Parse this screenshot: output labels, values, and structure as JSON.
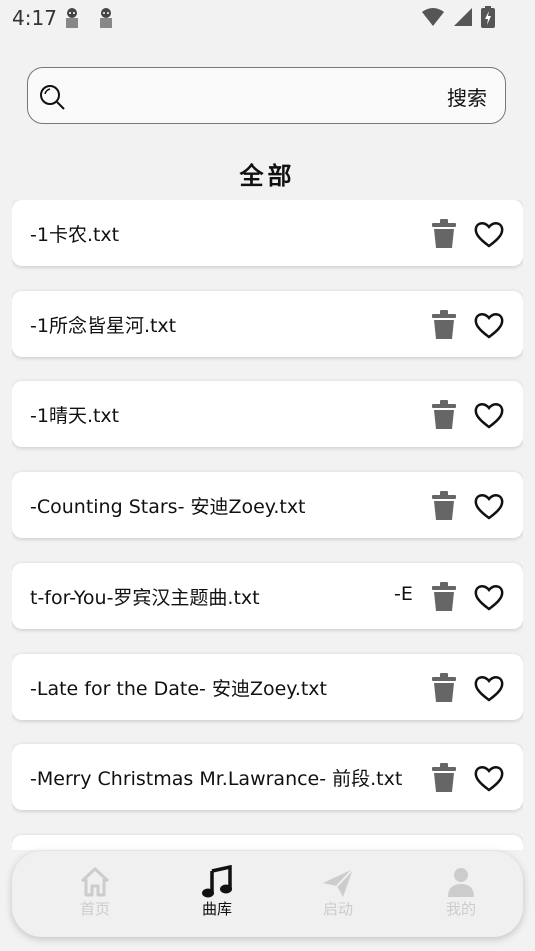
{
  "status_bar": {
    "time": "4:17"
  },
  "search": {
    "placeholder": "",
    "button_label": "搜索"
  },
  "section_title": "全部",
  "files": [
    {
      "name": "-1卡农.txt",
      "suffix": ""
    },
    {
      "name": "-1所念皆星河.txt",
      "suffix": ""
    },
    {
      "name": "-1晴天.txt",
      "suffix": ""
    },
    {
      "name": "-Counting Stars- 安迪Zoey.txt",
      "suffix": ""
    },
    {
      "name": "t-for-You-罗宾汉主题曲.txt",
      "suffix": "-E"
    },
    {
      "name": "-Late for the Date- 安迪Zoey.txt",
      "suffix": ""
    },
    {
      "name": "-Merry Christmas Mr.Lawrance- 前段.txt",
      "suffix": ""
    }
  ],
  "nav": {
    "items": [
      {
        "label": "首页",
        "icon": "home-icon",
        "active": false
      },
      {
        "label": "曲库",
        "icon": "music-note-icon",
        "active": true
      },
      {
        "label": "启动",
        "icon": "paper-plane-icon",
        "active": false
      },
      {
        "label": "我的",
        "icon": "person-icon",
        "active": false
      }
    ]
  },
  "colors": {
    "active": "#111111",
    "inactive": "#cccccc",
    "icon_gray": "#666666"
  }
}
